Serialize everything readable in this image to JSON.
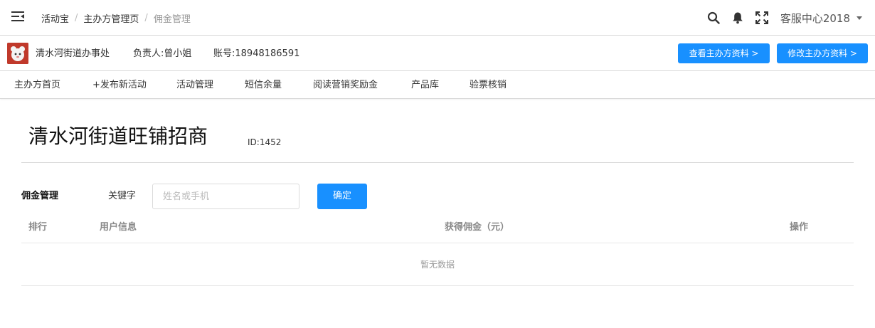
{
  "breadcrumb": [
    "活动宝",
    "主办方管理页",
    "佣金管理"
  ],
  "user": {
    "name": "客服中心2018"
  },
  "org": {
    "name": "清水河街道办事处",
    "contact": "负责人:曾小姐",
    "account": "账号:18948186591",
    "view_button": "查看主办方资料 >",
    "edit_button": "修改主办方资料 >"
  },
  "nav": [
    "主办方首页",
    "+发布新活动",
    "活动管理",
    "短信余量",
    "阅读营销奖励金",
    "产品库",
    "验票核销"
  ],
  "page": {
    "title": "清水河街道旺铺招商",
    "id": "ID:1452"
  },
  "filter": {
    "section": "佣金管理",
    "keyword_label": "关键字",
    "keyword_value": "",
    "placeholder": "姓名或手机",
    "confirm": "确定"
  },
  "table": {
    "columns": [
      "排行",
      "用户信息",
      "获得佣金（元）",
      "操作"
    ],
    "empty_text": "暂无数据"
  },
  "colors": {
    "primary": "#1890ff",
    "avatar": "#c0392b"
  },
  "icons": [
    "menu-icon",
    "search-icon",
    "bell-icon",
    "fullscreen-icon",
    "caret-down-icon"
  ]
}
